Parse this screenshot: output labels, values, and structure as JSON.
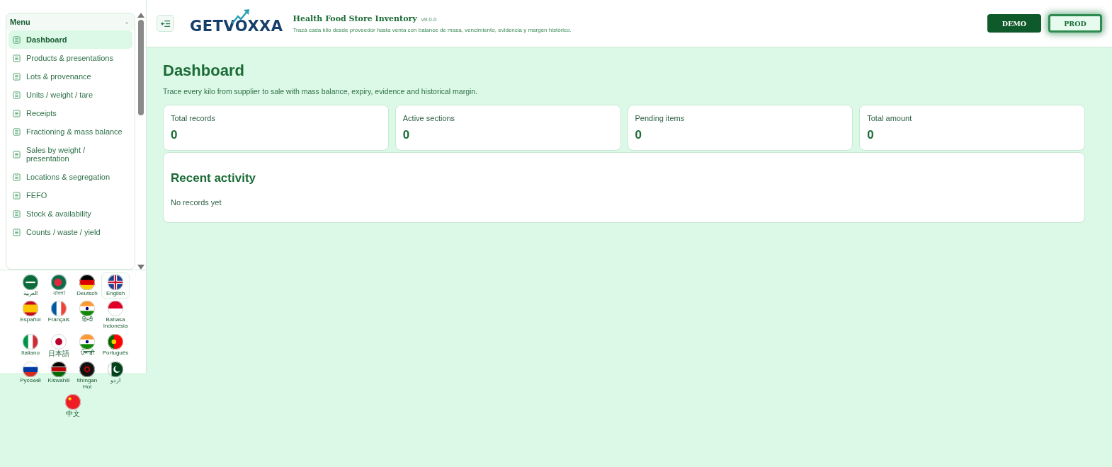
{
  "sidebar": {
    "menu_title": "Menu",
    "collapse": "-",
    "items": [
      {
        "label": "Dashboard",
        "selected": true
      },
      {
        "label": "Products & presentations",
        "selected": false
      },
      {
        "label": "Lots & provenance",
        "selected": false
      },
      {
        "label": "Units / weight / tare",
        "selected": false
      },
      {
        "label": "Receipts",
        "selected": false
      },
      {
        "label": "Fractioning & mass balance",
        "selected": false
      },
      {
        "label": "Sales by weight / presentation",
        "selected": false
      },
      {
        "label": "Locations & segregation",
        "selected": false
      },
      {
        "label": "FEFO",
        "selected": false
      },
      {
        "label": "Stock & availability",
        "selected": false
      },
      {
        "label": "Counts / waste / yield",
        "selected": false
      }
    ],
    "languages": [
      {
        "label": "العربية",
        "selected": false
      },
      {
        "label": "বাংলা",
        "selected": false
      },
      {
        "label": "Deutsch",
        "selected": false
      },
      {
        "label": "English",
        "selected": true
      },
      {
        "label": "Español",
        "selected": false
      },
      {
        "label": "Français",
        "selected": false
      },
      {
        "label": "हिन्दी",
        "selected": false
      },
      {
        "label": "Bahasa Indonesia",
        "selected": false
      },
      {
        "label": "Italiano",
        "selected": false
      },
      {
        "label": "日本語",
        "selected": false,
        "kind": "cjk"
      },
      {
        "label": "ਪੰਜਾਬੀ",
        "selected": false
      },
      {
        "label": "Português",
        "selected": false
      },
      {
        "label": "Русский",
        "selected": false
      },
      {
        "label": "Kiswahili",
        "selected": false
      },
      {
        "label": "tlhIngan Hol",
        "selected": false
      },
      {
        "label": "اردو",
        "selected": false
      },
      {
        "label": "中文",
        "selected": false,
        "kind": "cjk"
      }
    ]
  },
  "header": {
    "logo": "GETVOXXA",
    "title": "Health Food Store Inventory",
    "version": "v9.0.0",
    "subtitle": "Trazá cada kilo desde proveedor hasta venta con balance de masa, vencimiento, evidencia y margen histórico.",
    "environments": [
      {
        "label": "DEMO",
        "selected": false
      },
      {
        "label": "PROD",
        "selected": true
      }
    ]
  },
  "page": {
    "title": "Dashboard",
    "subtitle": "Trace every kilo from supplier to sale with mass balance, expiry, evidence and historical margin.",
    "stats": [
      {
        "label": "Total records",
        "value": "0"
      },
      {
        "label": "Active sections",
        "value": "0"
      },
      {
        "label": "Pending items",
        "value": "0"
      },
      {
        "label": "Total amount",
        "value": "0"
      }
    ],
    "recent": {
      "title": "Recent activity",
      "empty": "No records yet"
    }
  }
}
